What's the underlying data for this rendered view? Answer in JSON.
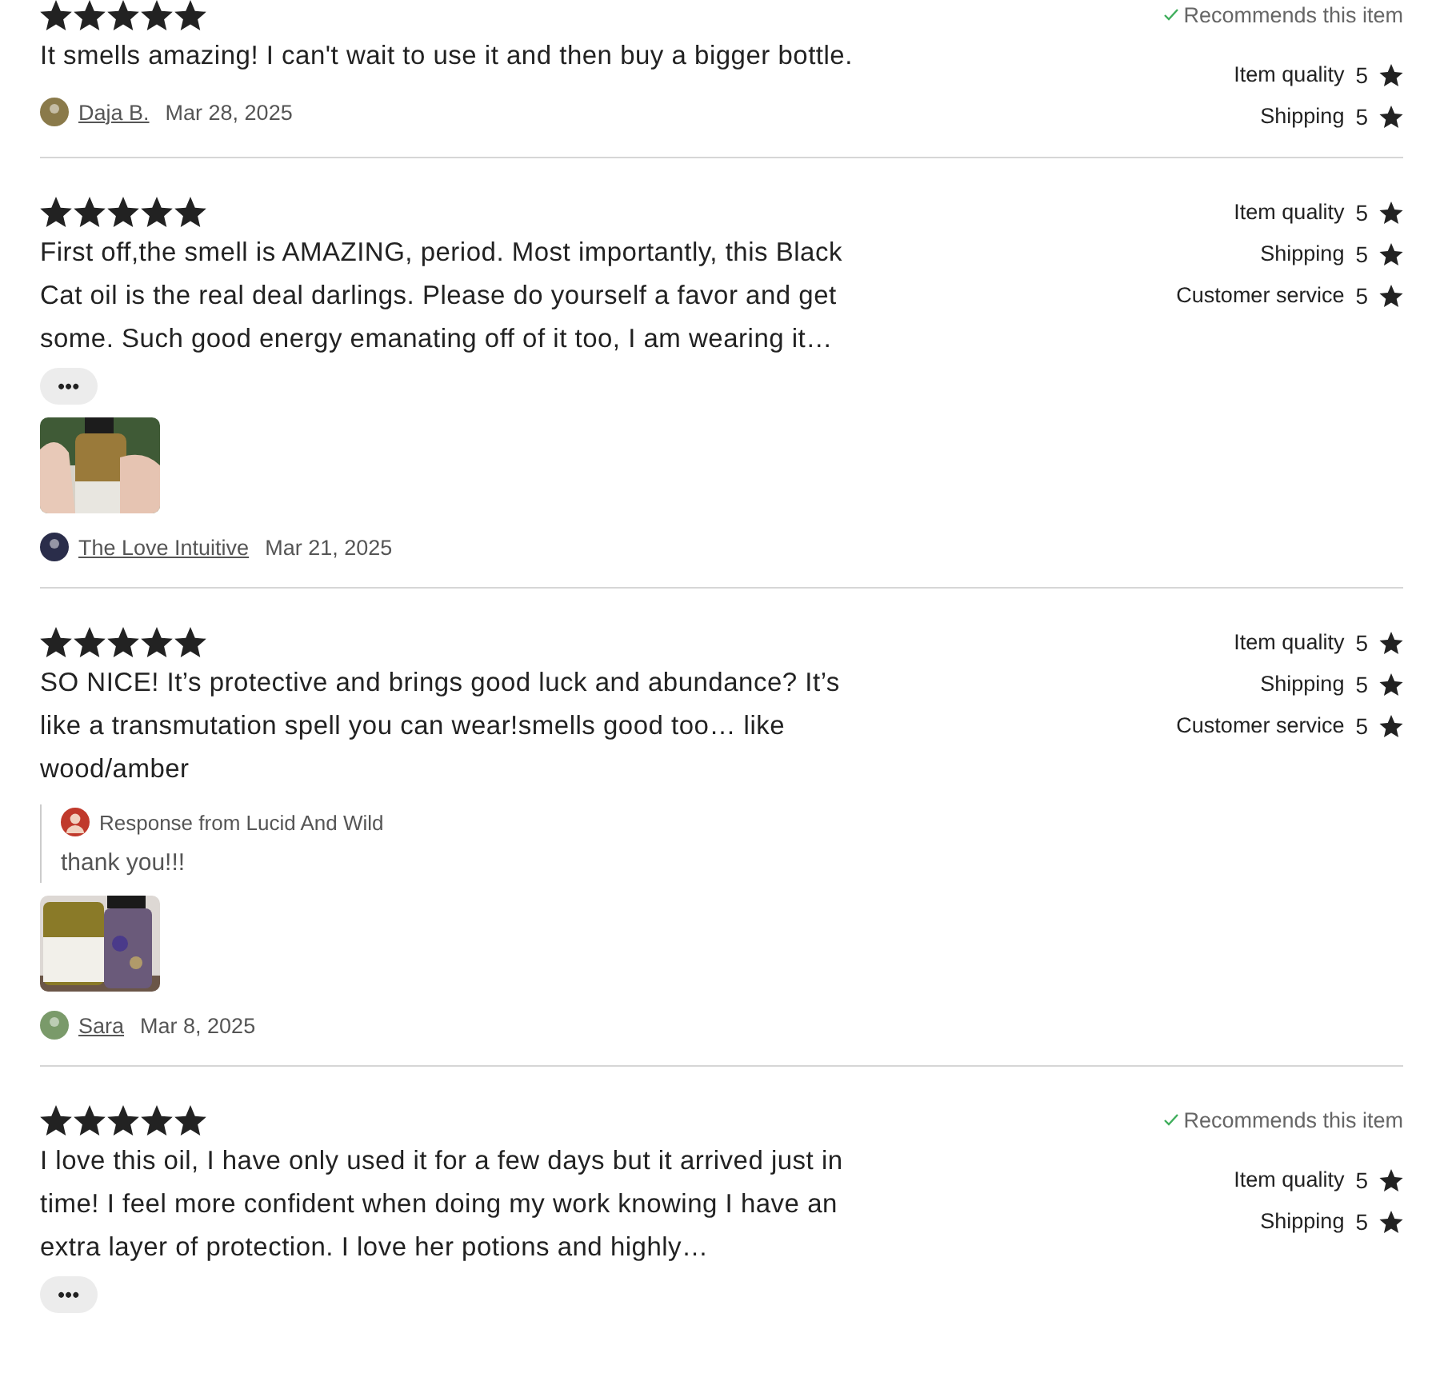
{
  "reviews": [
    {
      "stars": 5,
      "text": "It smells amazing! I can't wait to use it and then buy a bigger bottle.",
      "author": "Daja B.",
      "date": "Mar 28, 2025",
      "recommends": "Recommends this item",
      "ratings": [
        {
          "label": "Item quality",
          "value": "5"
        },
        {
          "label": "Shipping",
          "value": "5"
        }
      ]
    },
    {
      "stars": 5,
      "text": "First off,the smell is AMAZING, period. Most importantly, this Black Cat oil is the real deal darlings. Please do yourself a favor and get some. Such good energy emanating off of it too, I am wearing it…",
      "more": "•••",
      "photos": [
        {
          "kind": "picture"
        }
      ],
      "author": "The Love Intuitive",
      "date": "Mar 21, 2025",
      "ratings": [
        {
          "label": "Item quality",
          "value": "5"
        },
        {
          "label": "Shipping",
          "value": "5"
        },
        {
          "label": "Customer service",
          "value": "5"
        }
      ]
    },
    {
      "stars": 5,
      "text": "SO NICE! It’s protective and brings good luck and abundance? It’s like a transmutation spell you can wear!smells good too… like wood/amber",
      "response": {
        "from": "Response from Lucid And Wild",
        "text": "thank you!!!"
      },
      "photos": [
        {
          "kind": "picture"
        }
      ],
      "author": "Sara",
      "date": "Mar 8, 2025",
      "ratings": [
        {
          "label": "Item quality",
          "value": "5"
        },
        {
          "label": "Shipping",
          "value": "5"
        },
        {
          "label": "Customer service",
          "value": "5"
        }
      ]
    },
    {
      "stars": 5,
      "text": "I love this oil, I have only used it for a few days but it arrived just in time! I feel more confident when doing my work knowing I have an extra layer of protection. I love her potions and highly…",
      "more": "•••",
      "recommends": "Recommends this item",
      "ratings": [
        {
          "label": "Item quality",
          "value": "5"
        },
        {
          "label": "Shipping",
          "value": "5"
        }
      ]
    }
  ]
}
